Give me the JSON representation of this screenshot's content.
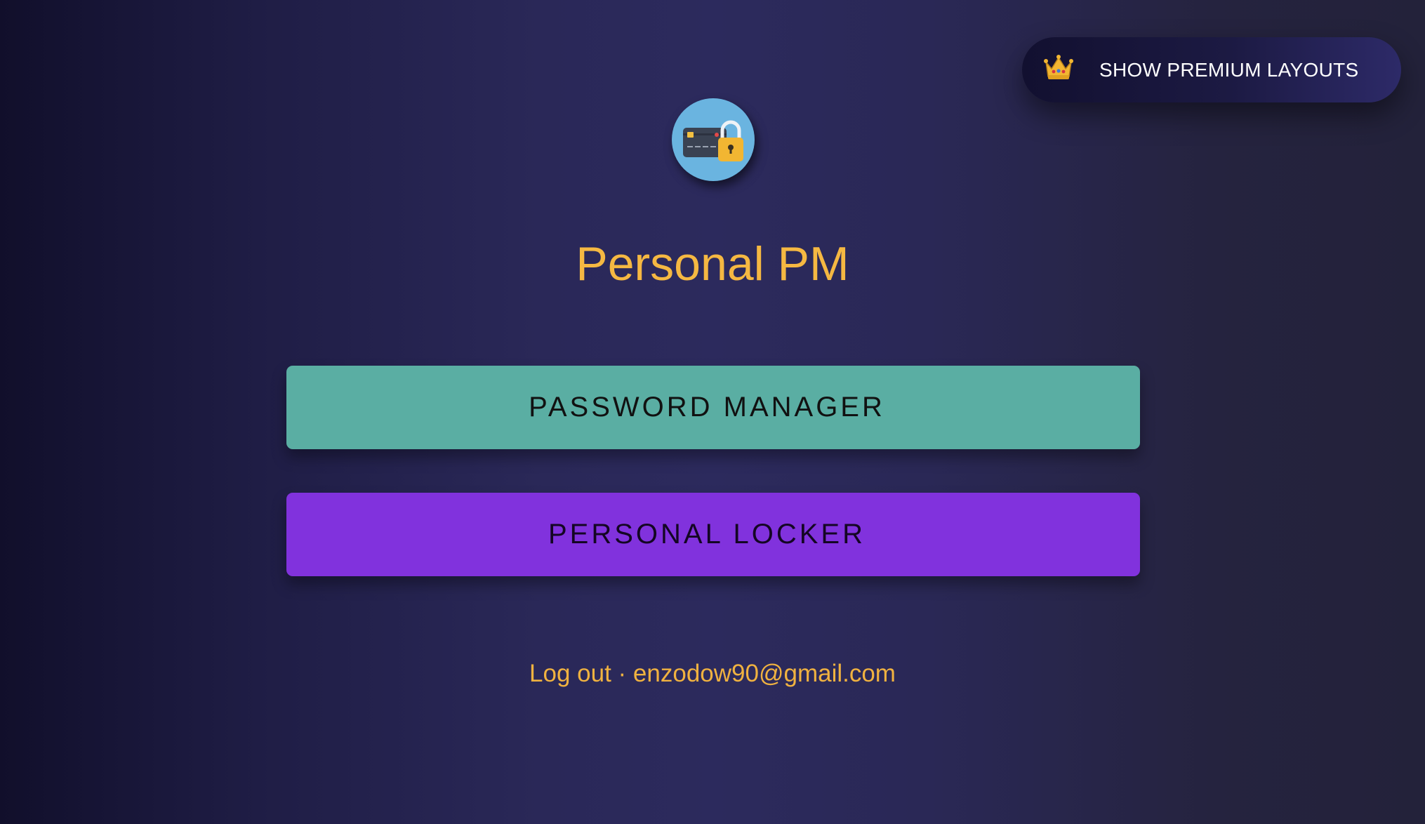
{
  "premium_button": {
    "icon": "crown-icon",
    "label": "SHOW PREMIUM LAYOUTS"
  },
  "logo": {
    "icon": "credit-card-lock-icon"
  },
  "app": {
    "title": "Personal PM"
  },
  "buttons": {
    "password_manager": "PASSWORD MANAGER",
    "personal_locker": "PERSONAL LOCKER"
  },
  "footer": {
    "logout_label": "Log out",
    "separator": "·",
    "email": "enzodow90@gmail.com"
  },
  "colors": {
    "accent_gold": "#f5b842",
    "password_button": "#5aaea3",
    "locker_button": "#8132dd",
    "logo_background": "#6ab4e0"
  }
}
